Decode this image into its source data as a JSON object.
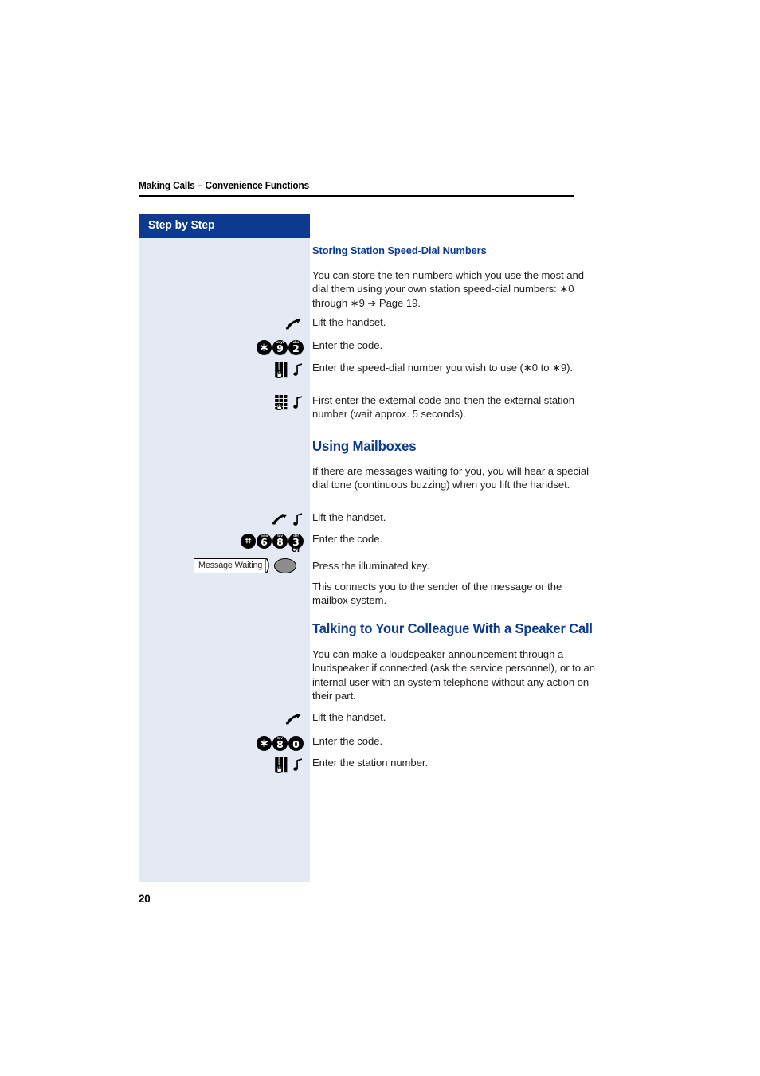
{
  "document": {
    "running_header": "Making Calls – Convenience Functions",
    "page_number": "20"
  },
  "sidebar": {
    "header_label": "Step by Step"
  },
  "colors": {
    "accent_blue": "#0b3a8f",
    "sidebar_fill": "#e5e9f4",
    "body_text": "#231f20",
    "key_fill": "#000000",
    "led_button_fill": "#8d8d8d"
  },
  "sections": [
    {
      "id": "storing-station-speed-dial-numbers",
      "heading": "Storing Station Speed-Dial Numbers",
      "heading_level": "sub",
      "intro": "You can store the ten numbers which you use the most and dial them using your own station speed-dial numbers: ∗0 through ∗9 ➔ Page 19.",
      "steps": [
        {
          "icons": [
            "handset-lift-icon"
          ],
          "text": "Lift the handset."
        },
        {
          "icons": [
            "key-star",
            "key-9",
            "key-2"
          ],
          "keys": [
            {
              "main": "∗",
              "sub": "",
              "style": "star"
            },
            {
              "main": "9",
              "sub": "wxyz",
              "style": "digit"
            },
            {
              "main": "2",
              "sub": "abc",
              "style": "digit"
            }
          ],
          "text": "Enter the code."
        },
        {
          "icons": [
            "keypad-icon",
            "tone-icon"
          ],
          "text": "Enter the speed-dial number you wish to use (∗0 to ∗9)."
        },
        {
          "icons": [
            "keypad-icon",
            "tone-icon"
          ],
          "text": "First enter the external code and then the external station number (wait approx. 5 seconds)."
        }
      ]
    },
    {
      "id": "using-mailboxes",
      "heading": "Using Mailboxes",
      "heading_level": "main",
      "intro": "If there are messages waiting for you, you will hear a special dial tone (continuous buzzing) when you lift the handset.",
      "steps": [
        {
          "icons": [
            "handset-lift-icon",
            "tone-icon"
          ],
          "text": "Lift the handset."
        },
        {
          "icons": [
            "key-hash",
            "key-6",
            "key-8",
            "key-3"
          ],
          "keys": [
            {
              "main": "⌗",
              "sub": "",
              "style": "hash"
            },
            {
              "main": "6",
              "sub": "mno",
              "style": "digit"
            },
            {
              "main": "8",
              "sub": "tuv",
              "style": "digit"
            },
            {
              "main": "3",
              "sub": "def",
              "style": "digit"
            }
          ],
          "text": "Enter the code."
        },
        {
          "icons": [
            "function-key-widget"
          ],
          "function_key_label": "Message Waiting",
          "text": "Press the illuminated key."
        },
        {
          "icons": [],
          "text": "This connects you to the sender of the message or the mailbox system."
        }
      ],
      "or_label": "or"
    },
    {
      "id": "talking-to-your-colleague-with-a-speaker-call",
      "heading": "Talking to Your Colleague With a Speaker Call",
      "heading_level": "main",
      "intro": "You can make a loudspeaker announcement through a loudspeaker if connected (ask the service personnel), or to an internal user with an system telephone without any action on their part.",
      "steps": [
        {
          "icons": [
            "handset-lift-icon"
          ],
          "text": "Lift the handset."
        },
        {
          "icons": [
            "key-star",
            "key-8",
            "key-0"
          ],
          "keys": [
            {
              "main": "∗",
              "sub": "",
              "style": "star"
            },
            {
              "main": "8",
              "sub": "tuv",
              "style": "digit"
            },
            {
              "main": "0",
              "sub": "",
              "style": "digit"
            }
          ],
          "text": "Enter the code."
        },
        {
          "icons": [
            "keypad-icon",
            "tone-icon"
          ],
          "text": "Enter the station number."
        }
      ]
    }
  ]
}
